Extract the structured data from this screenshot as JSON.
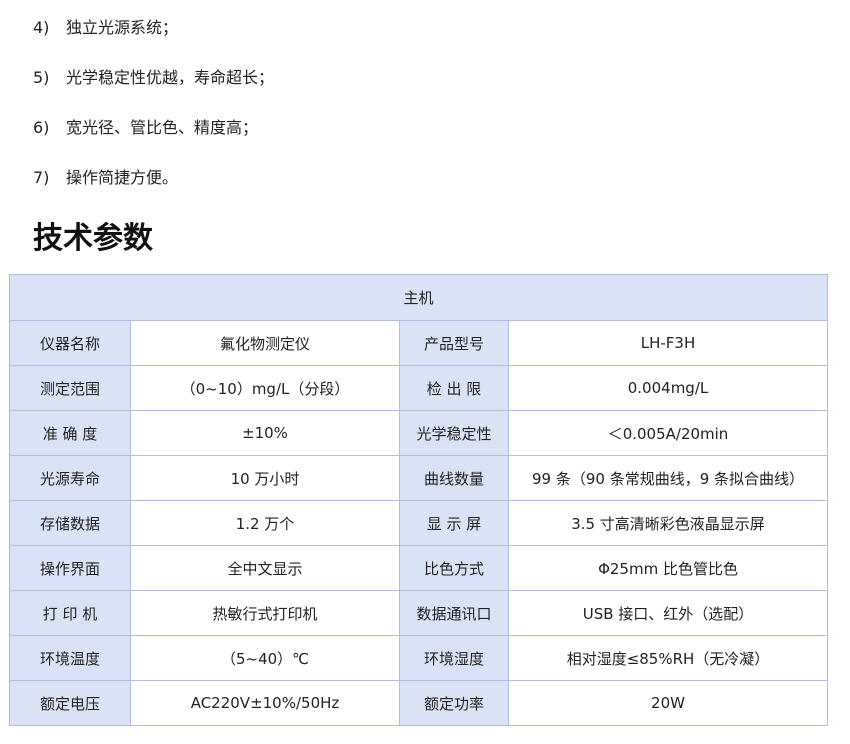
{
  "features": [
    {
      "num": "4)",
      "text": "独立光源系统；"
    },
    {
      "num": "5)",
      "text": "光学稳定性优越，寿命超长；"
    },
    {
      "num": "6)",
      "text": "宽光径、管比色、精度高；"
    },
    {
      "num": "7)",
      "text": "操作简捷方便。"
    }
  ],
  "section_title": "技术参数",
  "table": {
    "header": "主机",
    "rows": [
      {
        "label1": "仪器名称",
        "value1": "氟化物测定仪",
        "label2": "产品型号",
        "value2": "LH-F3H"
      },
      {
        "label1": "测定范围",
        "value1": "（0~10）mg/L（分段）",
        "label2": "检 出 限",
        "value2": "0.004mg/L"
      },
      {
        "label1": "准 确 度",
        "value1": "±10%",
        "label2": "光学稳定性",
        "value2": "＜0.005A/20min"
      },
      {
        "label1": "光源寿命",
        "value1": "10 万小时",
        "label2": "曲线数量",
        "value2": "99 条（90 条常规曲线，9 条拟合曲线）"
      },
      {
        "label1": "存储数据",
        "value1": "1.2 万个",
        "label2": "显 示 屏",
        "value2": "3.5 寸高清晰彩色液晶显示屏"
      },
      {
        "label1": "操作界面",
        "value1": "全中文显示",
        "label2": "比色方式",
        "value2": "Φ25mm 比色管比色"
      },
      {
        "label1": "打 印 机",
        "value1": "热敏行式打印机",
        "label2": "数据通讯口",
        "value2": "USB 接口、红外（选配）"
      },
      {
        "label1": "环境温度",
        "value1": "（5~40）℃",
        "label2": "环境湿度",
        "value2": "相对湿度≤85%RH（无冷凝）"
      },
      {
        "label1": "额定电压",
        "value1": "AC220V±10%/50Hz",
        "label2": "额定功率",
        "value2": "20W"
      }
    ]
  }
}
